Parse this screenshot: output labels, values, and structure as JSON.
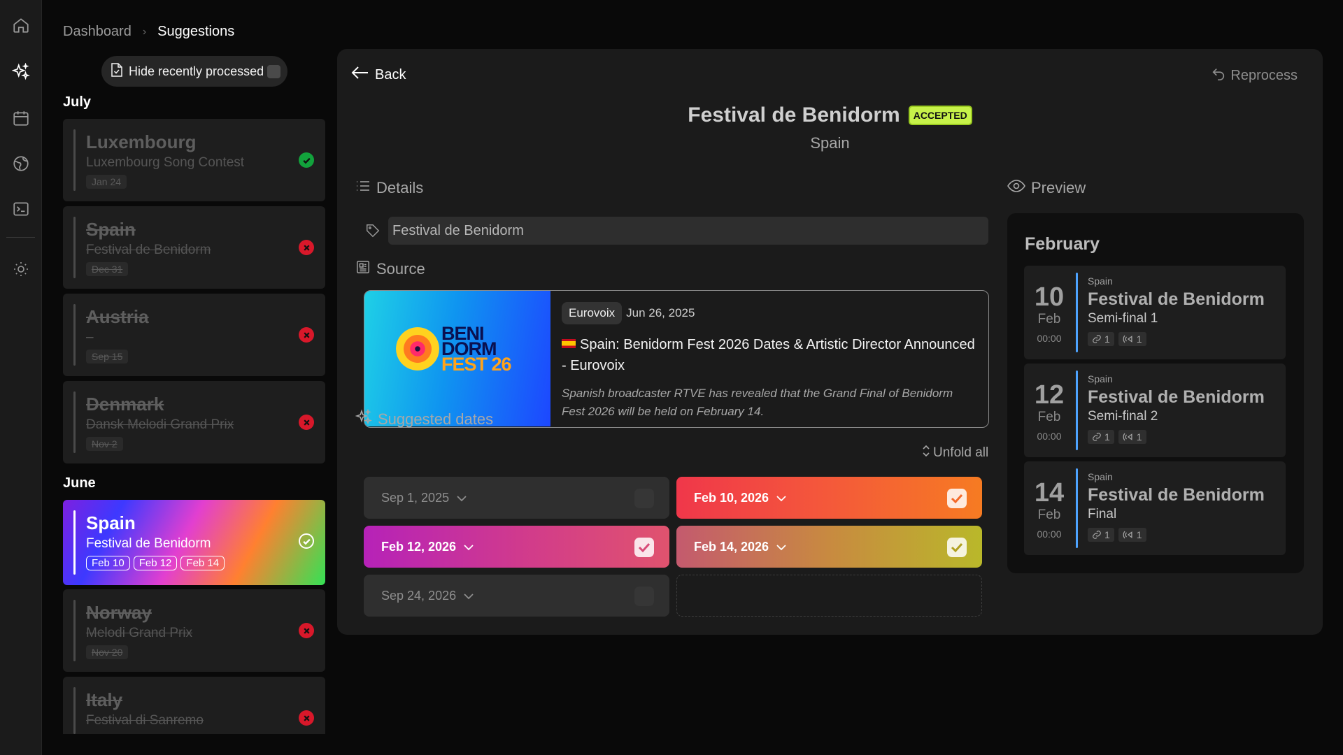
{
  "breadcrumb": {
    "root": "Dashboard",
    "current": "Suggestions"
  },
  "sidebar": {
    "hide_label": "Hide recently processed",
    "months": [
      "July",
      "June"
    ],
    "cards": [
      {
        "country": "Luxembourg",
        "event": "Luxembourg Song Contest",
        "date": "Jan 24",
        "status": "accepted"
      },
      {
        "country": "Spain",
        "event": "Festival de Benidorm",
        "date": "Dec 31",
        "status": "rejected"
      },
      {
        "country": "Austria",
        "event": "–",
        "date": "Sep 15",
        "status": "rejected"
      },
      {
        "country": "Denmark",
        "event": "Dansk Melodi Grand Prix",
        "date": "Nov 2",
        "status": "rejected"
      },
      {
        "country": "Spain",
        "event": "Festival de Benidorm",
        "dates": [
          "Feb 10",
          "Feb 12",
          "Feb 14"
        ],
        "status": "accepted",
        "active": true
      },
      {
        "country": "Norway",
        "event": "Melodi Grand Prix",
        "date": "Nov 20",
        "status": "rejected"
      },
      {
        "country": "Italy",
        "event": "Festival di Sanremo",
        "status": "rejected"
      }
    ]
  },
  "main": {
    "back_label": "Back",
    "reprocess_label": "Reprocess",
    "title": "Festival de Benidorm",
    "status_badge": "ACCEPTED",
    "country": "Spain",
    "details_label": "Details",
    "name_value": "Festival de Benidorm",
    "source_label": "Source",
    "source": {
      "publisher": "Eurovoix",
      "date": "Jun 26, 2025",
      "title": "Spain: Benidorm Fest 2026 Dates & Artistic Director Announced - Eurovoix",
      "description": "Spanish broadcaster RTVE has revealed that the Grand Final of Benidorm Fest 2026 will be held on February 14.",
      "logo_lines": [
        "BENI",
        "DORM",
        "FEST 26"
      ]
    },
    "suggested_label": "Suggested dates",
    "unfold_label": "Unfold all",
    "dates": [
      {
        "label": "Sep 1, 2025",
        "checked": false
      },
      {
        "label": "Feb 10, 2026",
        "checked": true
      },
      {
        "label": "Feb 12, 2026",
        "checked": true
      },
      {
        "label": "Feb 14, 2026",
        "checked": true
      },
      {
        "label": "Sep 24, 2026",
        "checked": false
      }
    ]
  },
  "preview": {
    "label": "Preview",
    "month": "February",
    "events": [
      {
        "day": "10",
        "month": "Feb",
        "time": "00:00",
        "country": "Spain",
        "title": "Festival de Benidorm",
        "subtitle": "Semi-final 1",
        "links": "1",
        "broadcasts": "1"
      },
      {
        "day": "12",
        "month": "Feb",
        "time": "00:00",
        "country": "Spain",
        "title": "Festival de Benidorm",
        "subtitle": "Semi-final 2",
        "links": "1",
        "broadcasts": "1"
      },
      {
        "day": "14",
        "month": "Feb",
        "time": "00:00",
        "country": "Spain",
        "title": "Festival de Benidorm",
        "subtitle": "Final",
        "links": "1",
        "broadcasts": "1"
      }
    ]
  },
  "colors": {
    "accent_badge": "#c7f24a",
    "accepted": "#12a23c",
    "rejected": "#d8182a"
  }
}
